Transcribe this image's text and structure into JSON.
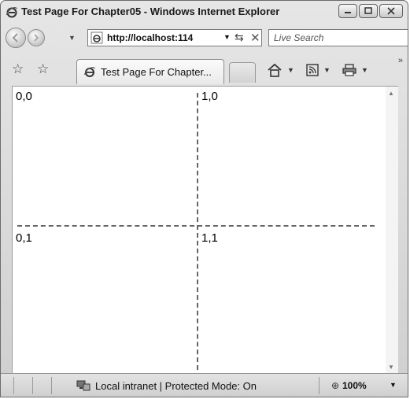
{
  "window": {
    "title": "Test Page For Chapter05 - Windows Internet Explorer",
    "caption_buttons": {
      "minimize_icon": "minimize-icon",
      "maximize_icon": "maximize-icon",
      "close_icon": "close-icon"
    }
  },
  "address": {
    "url": "http://localhost:114",
    "search_placeholder": "Live Search"
  },
  "tabs": [
    {
      "label": "Test Page For Chapter..."
    }
  ],
  "content": {
    "cells": [
      {
        "label": "0,0"
      },
      {
        "label": "1,0"
      },
      {
        "label": "0,1"
      },
      {
        "label": "1,1"
      }
    ]
  },
  "status": {
    "zone": "Local intranet | Protected Mode: On",
    "zoom": "100%"
  },
  "colors": {
    "chrome": "#d9d9d9",
    "content_bg": "#ffffff",
    "grid_line": "#666666"
  }
}
